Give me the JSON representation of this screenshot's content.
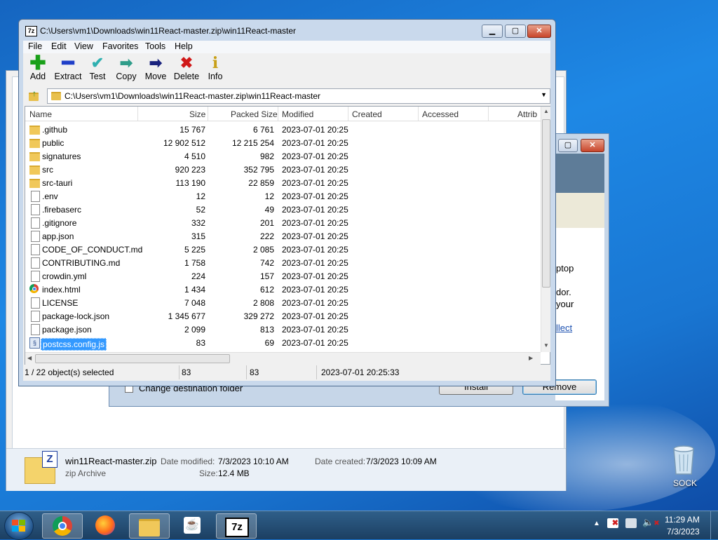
{
  "window": {
    "title": "C:\\Users\\vm1\\Downloads\\win11React-master.zip\\win11React-master",
    "address": "C:\\Users\\vm1\\Downloads\\win11React-master.zip\\win11React-master"
  },
  "menu": [
    "File",
    "Edit",
    "View",
    "Favorites",
    "Tools",
    "Help"
  ],
  "toolbar": {
    "add": "Add",
    "extract": "Extract",
    "test": "Test",
    "copy": "Copy",
    "move": "Move",
    "delete": "Delete",
    "info": "Info"
  },
  "columns": [
    "Name",
    "Size",
    "Packed Size",
    "Modified",
    "Created",
    "Accessed",
    "Attrib"
  ],
  "files": [
    {
      "name": ".github",
      "size": "15 767",
      "packed": "6 761",
      "modified": "2023-07-01 20:25",
      "type": "folder"
    },
    {
      "name": "public",
      "size": "12 902 512",
      "packed": "12 215 254",
      "modified": "2023-07-01 20:25",
      "type": "folder"
    },
    {
      "name": "signatures",
      "size": "4 510",
      "packed": "982",
      "modified": "2023-07-01 20:25",
      "type": "folder"
    },
    {
      "name": "src",
      "size": "920 223",
      "packed": "352 795",
      "modified": "2023-07-01 20:25",
      "type": "folder"
    },
    {
      "name": "src-tauri",
      "size": "113 190",
      "packed": "22 859",
      "modified": "2023-07-01 20:25",
      "type": "folder"
    },
    {
      "name": ".env",
      "size": "12",
      "packed": "12",
      "modified": "2023-07-01 20:25",
      "type": "file"
    },
    {
      "name": ".firebaserc",
      "size": "52",
      "packed": "49",
      "modified": "2023-07-01 20:25",
      "type": "file"
    },
    {
      "name": ".gitignore",
      "size": "332",
      "packed": "201",
      "modified": "2023-07-01 20:25",
      "type": "file"
    },
    {
      "name": "app.json",
      "size": "315",
      "packed": "222",
      "modified": "2023-07-01 20:25",
      "type": "file"
    },
    {
      "name": "CODE_OF_CONDUCT.md",
      "size": "5 225",
      "packed": "2 085",
      "modified": "2023-07-01 20:25",
      "type": "file"
    },
    {
      "name": "CONTRIBUTING.md",
      "size": "1 758",
      "packed": "742",
      "modified": "2023-07-01 20:25",
      "type": "file"
    },
    {
      "name": "crowdin.yml",
      "size": "224",
      "packed": "157",
      "modified": "2023-07-01 20:25",
      "type": "file"
    },
    {
      "name": "index.html",
      "size": "1 434",
      "packed": "612",
      "modified": "2023-07-01 20:25",
      "type": "chrome"
    },
    {
      "name": "LICENSE",
      "size": "7 048",
      "packed": "2 808",
      "modified": "2023-07-01 20:25",
      "type": "file"
    },
    {
      "name": "package-lock.json",
      "size": "1 345 677",
      "packed": "329 272",
      "modified": "2023-07-01 20:25",
      "type": "file"
    },
    {
      "name": "package.json",
      "size": "2 099",
      "packed": "813",
      "modified": "2023-07-01 20:25",
      "type": "file"
    },
    {
      "name": "postcss.config.js",
      "size": "83",
      "packed": "69",
      "modified": "2023-07-01 20:25",
      "type": "js",
      "selected": true
    }
  ],
  "status": {
    "selection": "1 / 22 object(s) selected",
    "size": "83",
    "packed": "83",
    "modified": "2023-07-01 20:25:33"
  },
  "setup": {
    "checkbox_label": "Change destination folder",
    "install": "Install",
    "remove": "Remove",
    "partial1": "ptop",
    "partial2": "dor.",
    "partial3": "your",
    "partial4": "llect"
  },
  "explorer_details": {
    "filename": "win11React-master.zip",
    "filetype": "zip Archive",
    "date_modified_label": "Date modified:",
    "date_modified": "7/3/2023 10:10 AM",
    "date_created_label": "Date created:",
    "date_created": "7/3/2023 10:09 AM",
    "size_label": "Size:",
    "size": "12.4 MB"
  },
  "desktop": {
    "recycle_label": "SOCK"
  },
  "clock": {
    "time": "11:29 AM",
    "date": "7/3/2023"
  }
}
